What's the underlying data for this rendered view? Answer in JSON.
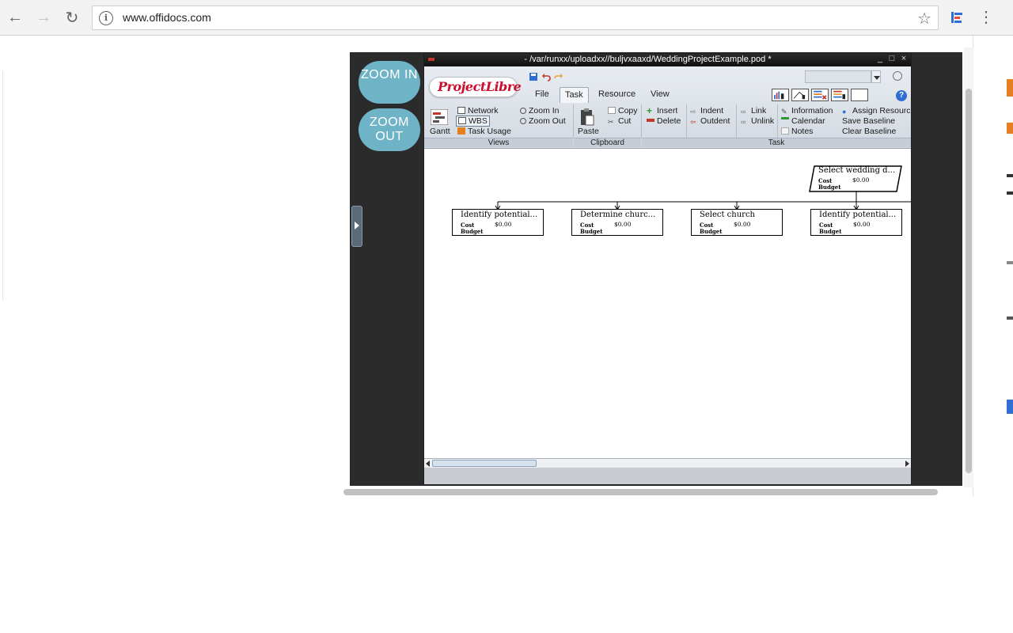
{
  "browser": {
    "url": "www.offidocs.com"
  },
  "zoom": {
    "in_label": "ZOOM IN",
    "out_label": "ZOOM OUT"
  },
  "app": {
    "title": "- /var/runxx/uploadxx//buljvxaaxd/WeddingProjectExample.pod *",
    "minimize": "_",
    "maximize": "□",
    "close": "×",
    "logo": "ProjectLibre",
    "tabs": [
      "File",
      "Task",
      "Resource",
      "View"
    ],
    "active_tab": "Task",
    "help": "?"
  },
  "ribbon": {
    "views": {
      "gantt": "Gantt",
      "network": "Network",
      "wbs": "WBS",
      "task_usage": "Task Usage",
      "zoom_in": "Zoom In",
      "zoom_out": "Zoom Out",
      "label": "Views"
    },
    "clipboard": {
      "paste": "Paste",
      "copy": "Copy",
      "cut": "Cut",
      "label": "Clipboard"
    },
    "task": {
      "insert": "Insert",
      "delete": "Delete",
      "indent": "Indent",
      "outdent": "Outdent",
      "link": "Link",
      "unlink": "Unlink",
      "information": "Information",
      "calendar": "Calendar",
      "notes": "Notes",
      "assign_resources": "Assign Resourc",
      "save_baseline": "Save Baseline",
      "clear_baseline": "Clear Baseline",
      "label": "Task"
    }
  },
  "wbs": {
    "summary": {
      "title": "Select wedding d...",
      "cost_label": "Cost",
      "cost_value": "$0.00",
      "budget_label": "Budget"
    },
    "children": [
      {
        "title": "Identify potential...",
        "cost_label": "Cost",
        "cost_value": "$0.00",
        "budget_label": "Budget"
      },
      {
        "title": "Determine churc...",
        "cost_label": "Cost",
        "cost_value": "$0.00",
        "budget_label": "Budget"
      },
      {
        "title": "Select church",
        "cost_label": "Cost",
        "cost_value": "$0.00",
        "budget_label": "Budget"
      },
      {
        "title": "Identify potential...",
        "cost_label": "Cost",
        "cost_value": "$0.00",
        "budget_label": "Budget"
      }
    ]
  },
  "colors": {
    "zoom_button": "#6fb3c7",
    "dark_panel": "#2b2b2b",
    "logo_red": "#c8102e"
  }
}
